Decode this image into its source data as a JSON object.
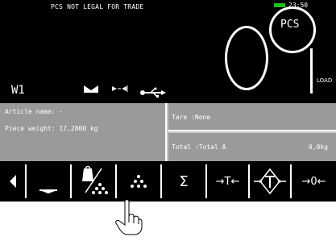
{
  "display": {
    "legal_notice": "PCS NOT LEGAL FOR TRADE",
    "time": "23:50",
    "unit_label": "PCS",
    "weight_value": "0",
    "load_label": "LOAD",
    "channel": "W1",
    "battery_color": "#22bb22"
  },
  "info": {
    "article_name": "Article name: -",
    "piece_weight": "Piece weight: 17,2800 kg",
    "tare": "Tare  :None",
    "total": "Total :Total A",
    "total_value": "0,0kg"
  },
  "keys": [
    {
      "name": "scroll-left-key",
      "icon": "triangle-left-icon"
    },
    {
      "name": "underscore-key",
      "icon": "underscore-icon"
    },
    {
      "name": "piece-weight-key",
      "icon": "weight-divide-pieces-icon"
    },
    {
      "name": "pieces-key",
      "icon": "pieces-dots-icon"
    },
    {
      "name": "sum-key",
      "label": "Σ",
      "icon": "sigma-icon"
    },
    {
      "name": "tare-key",
      "label": "→T←",
      "icon": "tare-icon"
    },
    {
      "name": "preset-tare-key",
      "icon": "preset-tare-icon"
    },
    {
      "name": "zero-key",
      "label": "→0←",
      "icon": "zero-icon"
    }
  ],
  "cursor": {
    "icon": "pointing-hand-icon"
  }
}
